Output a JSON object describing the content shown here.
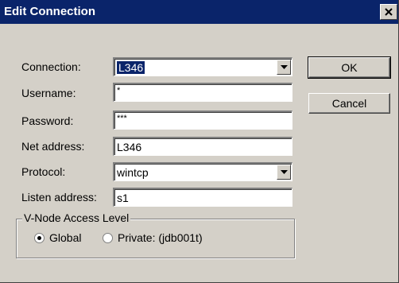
{
  "dialog": {
    "title": "Edit Connection",
    "close_glyph": "×"
  },
  "form": {
    "connection": {
      "label": "Connection:",
      "value": "L346"
    },
    "username": {
      "label": "Username:",
      "value": "*"
    },
    "password": {
      "label": "Password:",
      "value": "***"
    },
    "net_address": {
      "label": "Net address:",
      "value": "L346"
    },
    "protocol": {
      "label": "Protocol:",
      "value": "wintcp"
    },
    "listen_address": {
      "label": "Listen address:",
      "value": "s1"
    }
  },
  "buttons": {
    "ok": "OK",
    "cancel": "Cancel"
  },
  "access_level": {
    "title": "V-Node Access Level",
    "options": [
      {
        "label": "Global",
        "selected": true
      },
      {
        "label": "Private: (jdb001t)",
        "selected": false
      }
    ]
  },
  "colors": {
    "titlebar": "#0a246a",
    "face": "#d4d0c8",
    "selection": "#0a246a"
  },
  "icons": {
    "close": "close-icon",
    "dropdown": "chevron-down-icon",
    "radio_on": "radio-selected-icon",
    "radio_off": "radio-unselected-icon"
  }
}
